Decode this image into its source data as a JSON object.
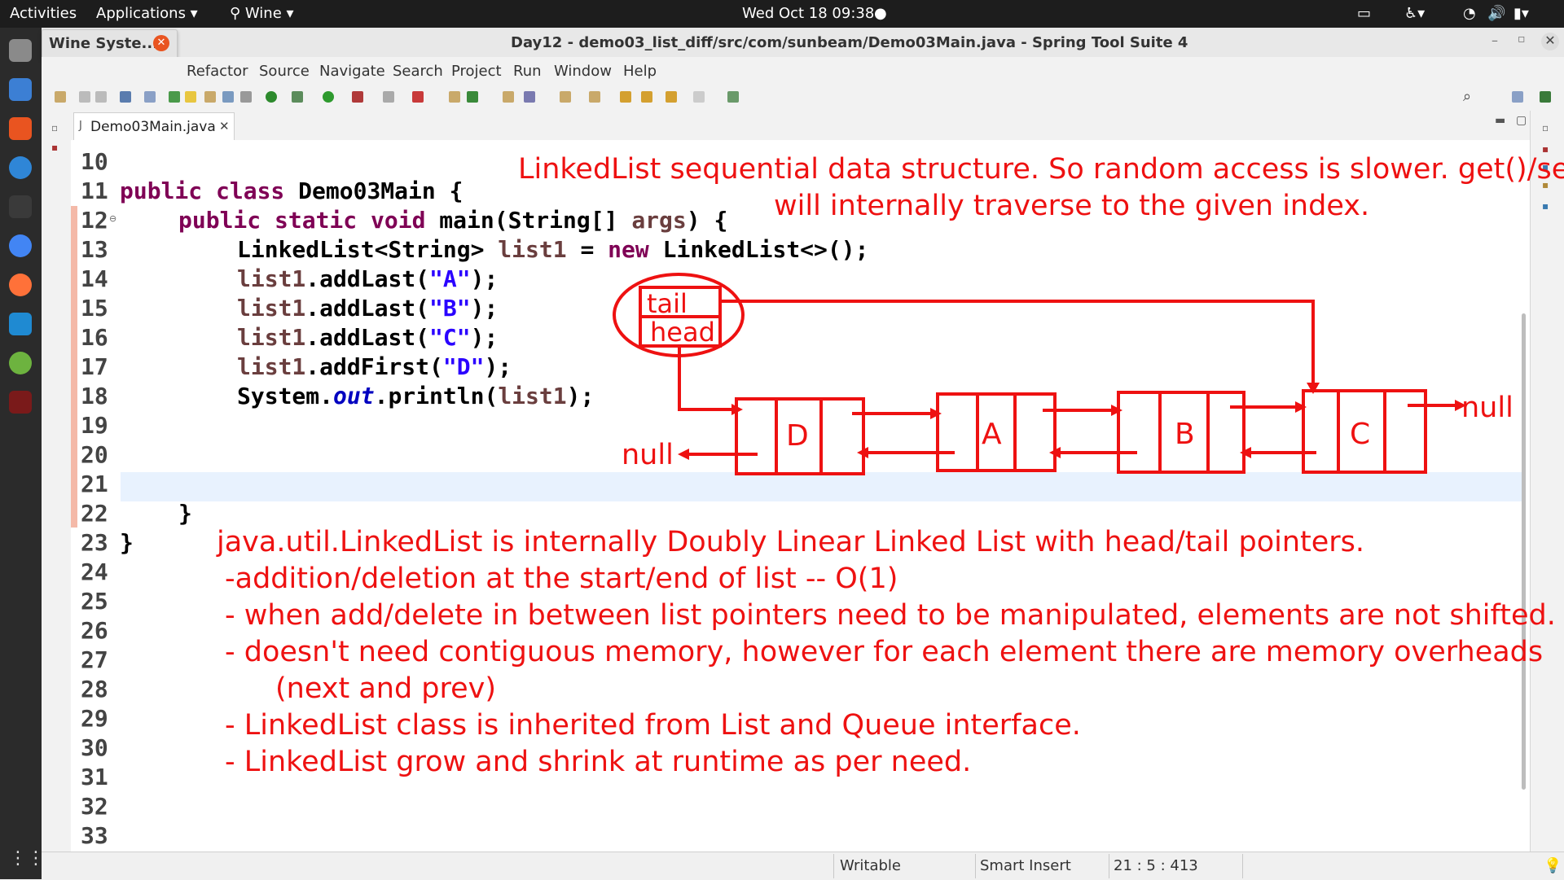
{
  "topbar": {
    "activities": "Activities",
    "applications": "Applications ▾",
    "wine": "Wine ▾",
    "datetime": "Wed Oct 18  09:38"
  },
  "wine_popup": {
    "label": "Wine Syste..."
  },
  "window": {
    "title": "Day12 - demo03_list_diff/src/com/sunbeam/Demo03Main.java - Spring Tool Suite 4"
  },
  "menu": [
    "Refactor",
    "Source",
    "Navigate",
    "Search",
    "Project",
    "Run",
    "Window",
    "Help"
  ],
  "editor_tab": {
    "label": "Demo03Main.java"
  },
  "line_numbers": [
    "10",
    "11",
    "12",
    "13",
    "14",
    "15",
    "16",
    "17",
    "18",
    "19",
    "20",
    "21",
    "22",
    "23",
    "24",
    "25",
    "26",
    "27",
    "28",
    "29",
    "30",
    "31",
    "32",
    "33"
  ],
  "code": {
    "l11_kw": "public class",
    "l11_rest": " Demo03Main {",
    "l12_kw": "public static void",
    "l12_rest": " main(String[] ",
    "l12_args": "args",
    "l12_end": ") {",
    "l13_a": "LinkedList<String> ",
    "l13_b": "list1",
    "l13_c": " = ",
    "l13_kw": "new",
    "l13_d": " LinkedList<>();",
    "l14_a": "list1",
    "l14_b": ".addLast(",
    "l14_s": "\"A\"",
    "l14_c": ");",
    "l15_a": "list1",
    "l15_b": ".addLast(",
    "l15_s": "\"B\"",
    "l15_c": ");",
    "l16_a": "list1",
    "l16_b": ".addLast(",
    "l16_s": "\"C\"",
    "l16_c": ");",
    "l17_a": "list1",
    "l17_b": ".addFirst(",
    "l17_s": "\"D\"",
    "l17_c": ");",
    "l18_a": "System.",
    "l18_f": "out",
    "l18_b": ".println(",
    "l18_c": "list1",
    "l18_d": ");",
    "l22": "}",
    "l23": "}"
  },
  "annotations": {
    "top_1": "LinkedList sequential data structure. So random access is slower. get()/set()",
    "top_2": "will internally traverse to the given index.",
    "diagram": {
      "tail": "tail",
      "head": "head",
      "nodes": [
        "D",
        "A",
        "B",
        "C"
      ],
      "null_left": "null",
      "null_right": "null"
    },
    "bottom": [
      "java.util.LinkedList is internally Doubly Linear Linked List with head/tail pointers.",
      "-addition/deletion at the start/end of list -- O(1)",
      "- when add/delete in between list pointers need to be manipulated, elements are not shifted.",
      "- doesn't need contiguous memory, however for each element there are memory overheads",
      "(next and prev)",
      "- LinkedList class is inherited from List and Queue interface.",
      "- LinkedList grow and shrink at runtime as per need."
    ]
  },
  "status": {
    "writable": "Writable",
    "insert_mode": "Smart Insert",
    "position": "21 : 5 : 413"
  },
  "colors": {
    "annotation": "#ee1111",
    "keyword": "#7f0055",
    "string": "#2a00ff",
    "field": "#0000c0"
  }
}
